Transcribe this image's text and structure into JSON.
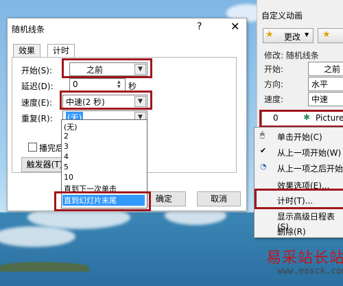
{
  "dialog": {
    "title": "随机线条",
    "help": "?",
    "close": "✕",
    "tabs": [
      "效果",
      "计时"
    ],
    "start_label": "开始(S):",
    "start_value": "之前",
    "delay_label": "延迟(D):",
    "delay_value": "0",
    "delay_unit": "秒",
    "speed_label": "速度(E):",
    "speed_value": "中速(2 秒)",
    "repeat_label": "重复(R):",
    "repeat_value": "(无)",
    "rewind_label": "播完后快",
    "trigger_label": "触发器(T)",
    "ok_label": "确定",
    "cancel_label": "取消",
    "repeat_options": [
      "(无)",
      "2",
      "3",
      "4",
      "5",
      "10",
      "直到下一次单击",
      "直到幻灯片末尾"
    ],
    "repeat_selected": "直到幻灯片末尾"
  },
  "pane": {
    "title": "自定义动画",
    "change_label": "更改",
    "modify_label": "修改: 随机线条",
    "start_label": "开始:",
    "start_value": "之前",
    "direction_label": "方向:",
    "direction_value": "水平",
    "speed_label": "速度:",
    "speed_value": "中速",
    "list_item_index": "0",
    "list_item_name": "Picture"
  },
  "context_menu": {
    "items": [
      "单击开始(C)",
      "从上一项开始(W)",
      "从上一项之后开始",
      "效果选项(E)...",
      "计时(T)...",
      "显示高级日程表(S)",
      "删除(R)"
    ]
  },
  "watermark": {
    "text": "易采站长站",
    "url": "www.easck.com"
  },
  "colors": {
    "highlight": "#a0151b",
    "selection": "#3399ff",
    "sky": "#8cc4ea"
  }
}
